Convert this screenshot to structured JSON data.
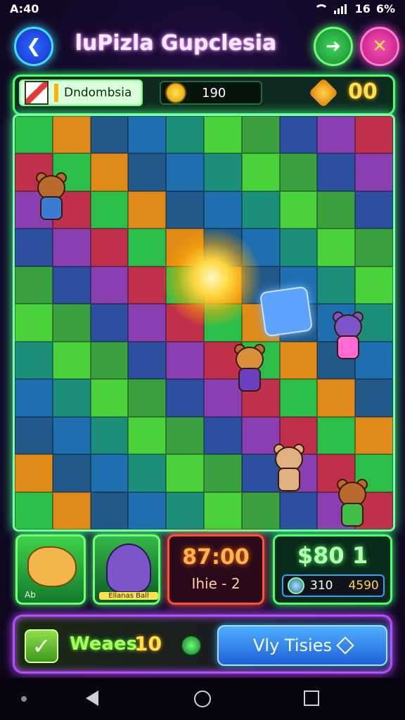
{
  "status_bar": {
    "time": "A:40",
    "signal": "16",
    "battery": "6%"
  },
  "header": {
    "title": "luPizla Gupclesia"
  },
  "top_bar": {
    "player_name": "Dndombsia",
    "coins": "190",
    "gems": "00"
  },
  "cards": {
    "card_a_label": "Ab",
    "card_b_label": "Ellanas Ball",
    "score_main": "87:00",
    "score_sub": "Ihie - 2",
    "cash_main": "$80 1",
    "cash_a": "310",
    "cash_b": "4590"
  },
  "bottom_bar": {
    "waves_label": "Weaes",
    "waves_count": "10",
    "tiles_button": "Vly Tisies"
  },
  "colors": {
    "accent_green": "#4bff6e",
    "accent_purple": "#b84dff",
    "accent_blue": "#2ea0ff",
    "accent_red": "#ff4f3a",
    "gold": "#ffe14d"
  }
}
